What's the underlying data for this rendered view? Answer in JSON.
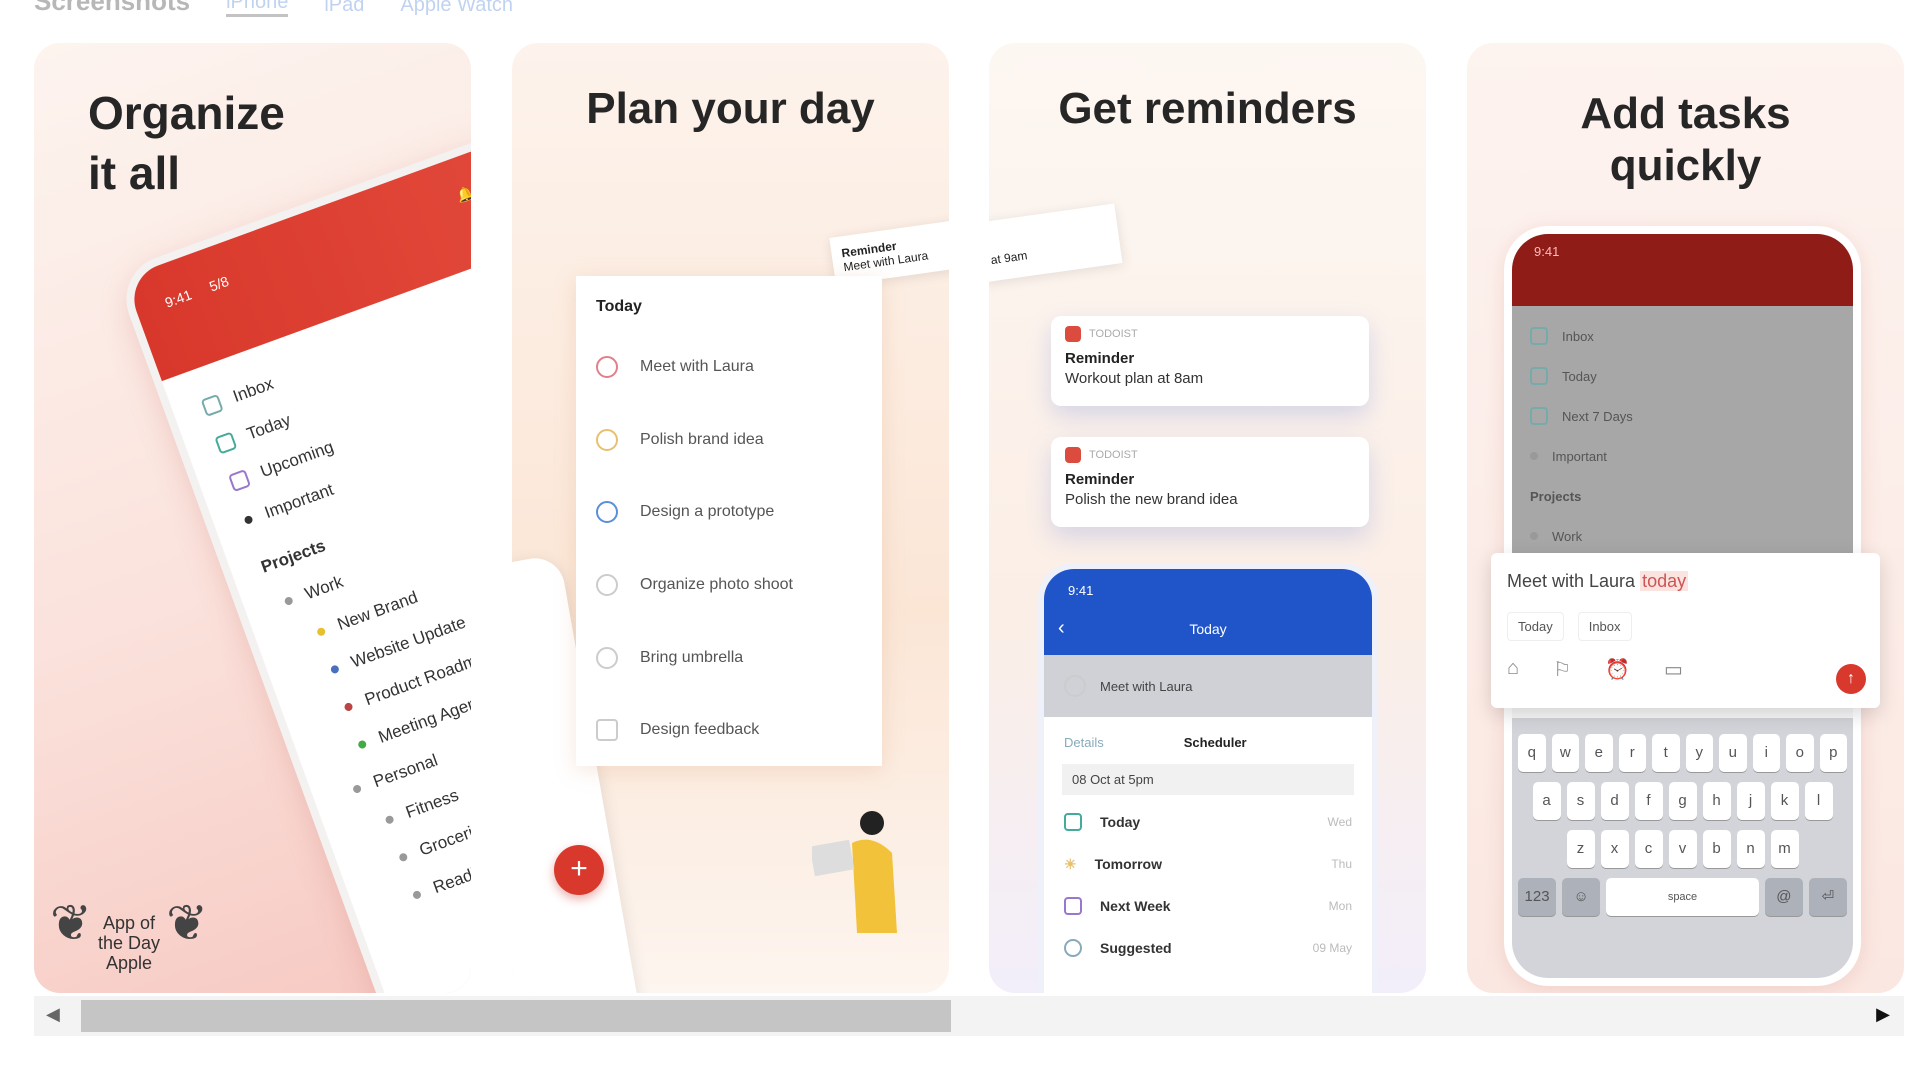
{
  "header": {
    "title": "Screenshots",
    "tabs": [
      "iPhone",
      "iPad",
      "Apple Watch"
    ]
  },
  "cards": [
    {
      "title_line1": "Organize",
      "title_line2": "it all",
      "phone": {
        "time": "9:41",
        "count": "5/8",
        "items": [
          "Inbox",
          "Today",
          "Upcoming",
          "Important"
        ],
        "section": "Projects",
        "projects": [
          "Work",
          "New Brand",
          "Website Update",
          "Product Roadmap",
          "Meeting Agenda",
          "Personal",
          "Fitness",
          "Groceries",
          "Reading List"
        ]
      },
      "badge": {
        "line1": "App of",
        "line2": "the Day",
        "line3": "Apple"
      }
    },
    {
      "title": "Plan your day",
      "list_title": "Today",
      "tasks": [
        {
          "label": "Meet with Laura",
          "color": "#e0808a"
        },
        {
          "label": "Polish brand idea",
          "color": "#e8c070"
        },
        {
          "label": "Design a prototype",
          "color": "#5b8fd6"
        },
        {
          "label": "Organize photo shoot",
          "color": "#cccccc"
        },
        {
          "label": "Bring umbrella",
          "color": "#cccccc"
        },
        {
          "label": "Design feedback",
          "color": "#cccccc"
        }
      ],
      "notification": {
        "title": "Reminder",
        "body": "Meet with Laura"
      }
    },
    {
      "title": "Get reminders",
      "partial_notification": "at 9am",
      "notifications": [
        {
          "app": "TODOIST",
          "title": "Reminder",
          "body": "Workout plan at 8am"
        },
        {
          "app": "TODOIST",
          "title": "Reminder",
          "body": "Polish the new brand idea"
        }
      ],
      "phone": {
        "time": "9:41",
        "title": "Today",
        "task": "Meet with Laura",
        "tabs": [
          "Details",
          "Scheduler"
        ],
        "field": "08 Oct at 5pm",
        "options": [
          {
            "label": "Today",
            "day": "Wed"
          },
          {
            "label": "Tomorrow",
            "day": "Thu"
          },
          {
            "label": "Next Week",
            "day": "Mon"
          },
          {
            "label": "Suggested",
            "day": "09 May"
          }
        ]
      }
    },
    {
      "title_line1": "Add tasks",
      "title_line2": "quickly",
      "phone": {
        "time": "9:41",
        "items": [
          "Inbox",
          "Today",
          "Next 7 Days",
          "Important"
        ],
        "section": "Projects",
        "sub": "Work"
      },
      "quick_add": {
        "text": "Meet with Laura",
        "date_token": "today",
        "chips": [
          "Today",
          "Inbox"
        ]
      },
      "keyboard": {
        "rows": [
          [
            "q",
            "w",
            "e",
            "r",
            "t",
            "y",
            "u",
            "i",
            "o",
            "p"
          ],
          [
            "a",
            "s",
            "d",
            "f",
            "g",
            "h",
            "j",
            "k",
            "l"
          ],
          [
            "z",
            "x",
            "c",
            "v",
            "b",
            "n",
            "m"
          ]
        ],
        "space": "space",
        "num": "123"
      }
    }
  ],
  "scrollbar": {
    "position_fraction": 0.0,
    "visible_fraction": 0.49
  },
  "colors": {
    "todoist_red": "#db4c3f",
    "blue_header": "#1f55c8"
  }
}
